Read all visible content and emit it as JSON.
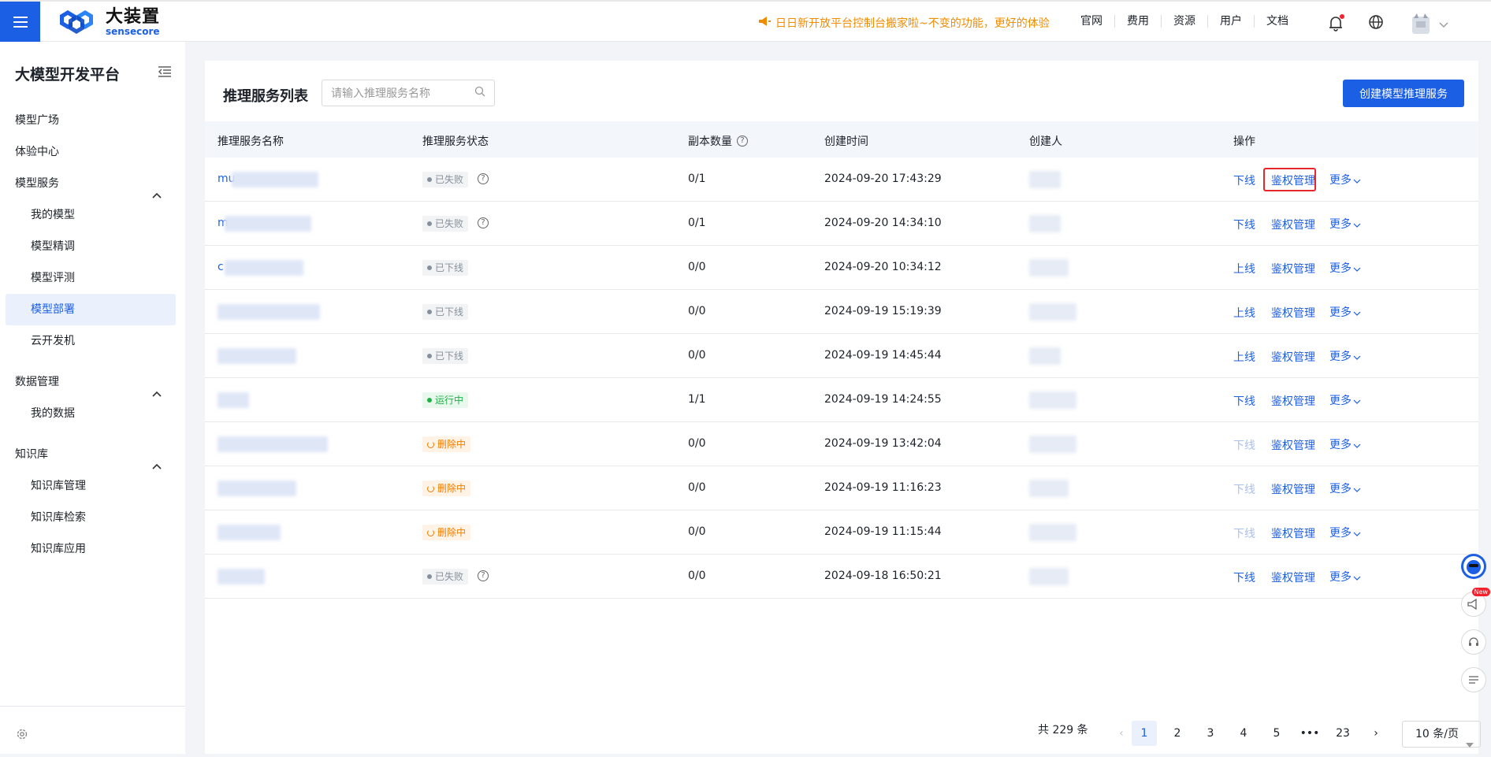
{
  "header": {
    "logo_cn": "大装置",
    "logo_en": "sensecore",
    "notice": "日日新开放平台控制台搬家啦~不变的功能，更好的体验",
    "links": [
      "官网",
      "费用",
      "资源",
      "用户",
      "文档"
    ]
  },
  "sidebar": {
    "title": "大模型开发平台",
    "items": [
      {
        "label": "模型广场"
      },
      {
        "label": "体验中心"
      },
      {
        "label": "模型服务"
      },
      {
        "label": "我的模型"
      },
      {
        "label": "模型精调"
      },
      {
        "label": "模型评测"
      },
      {
        "label": "模型部署"
      },
      {
        "label": "云开发机"
      },
      {
        "label": "数据管理"
      },
      {
        "label": "我的数据"
      },
      {
        "label": "知识库"
      },
      {
        "label": "知识库管理"
      },
      {
        "label": "知识库检索"
      },
      {
        "label": "知识库应用"
      }
    ]
  },
  "main": {
    "title": "推理服务列表",
    "search_placeholder": "请输入推理服务名称",
    "create_button": "创建模型推理服务",
    "columns": [
      "推理服务名称",
      "推理服务状态",
      "副本数量",
      "创建时间",
      "创建人",
      "操作"
    ],
    "rows": [
      {
        "name": "mu",
        "status": "已失败",
        "replicas": "0/1",
        "created": "2024-09-20 17:43:29",
        "action1": "下线",
        "auth": "鉴权管理",
        "more": "更多"
      },
      {
        "name": "m",
        "status": "已失败",
        "replicas": "0/1",
        "created": "2024-09-20 14:34:10",
        "action1": "下线",
        "auth": "鉴权管理",
        "more": "更多"
      },
      {
        "name": "c",
        "status": "已下线",
        "replicas": "0/0",
        "created": "2024-09-20 10:34:12",
        "action1": "上线",
        "auth": "鉴权管理",
        "more": "更多"
      },
      {
        "name": "",
        "status": "已下线",
        "replicas": "0/0",
        "created": "2024-09-19 15:19:39",
        "action1": "上线",
        "auth": "鉴权管理",
        "more": "更多"
      },
      {
        "name": "",
        "status": "已下线",
        "replicas": "0/0",
        "created": "2024-09-19 14:45:44",
        "action1": "上线",
        "auth": "鉴权管理",
        "more": "更多"
      },
      {
        "name": "",
        "status": "运行中",
        "replicas": "1/1",
        "created": "2024-09-19 14:24:55",
        "action1": "下线",
        "auth": "鉴权管理",
        "more": "更多"
      },
      {
        "name": "",
        "status": "删除中",
        "replicas": "0/0",
        "created": "2024-09-19 13:42:04",
        "action1": "下线",
        "auth": "鉴权管理",
        "more": "更多"
      },
      {
        "name": "",
        "status": "删除中",
        "replicas": "0/0",
        "created": "2024-09-19 11:16:23",
        "action1": "下线",
        "auth": "鉴权管理",
        "more": "更多"
      },
      {
        "name": "",
        "status": "删除中",
        "replicas": "0/0",
        "created": "2024-09-19 11:15:44",
        "action1": "下线",
        "auth": "鉴权管理",
        "more": "更多"
      },
      {
        "name": "",
        "status": "已失败",
        "replicas": "0/0",
        "created": "2024-09-18 16:50:21",
        "action1": "下线",
        "auth": "鉴权管理",
        "more": "更多"
      }
    ]
  },
  "pagination": {
    "total": "共 229 条",
    "pages": [
      "1",
      "2",
      "3",
      "4",
      "5",
      "•••",
      "23"
    ],
    "page_size": "10 条/页"
  },
  "float_tools": {
    "new_badge": "New"
  },
  "colors": {
    "primary": "#1b5fe5",
    "highlight": "#e8272c"
  }
}
